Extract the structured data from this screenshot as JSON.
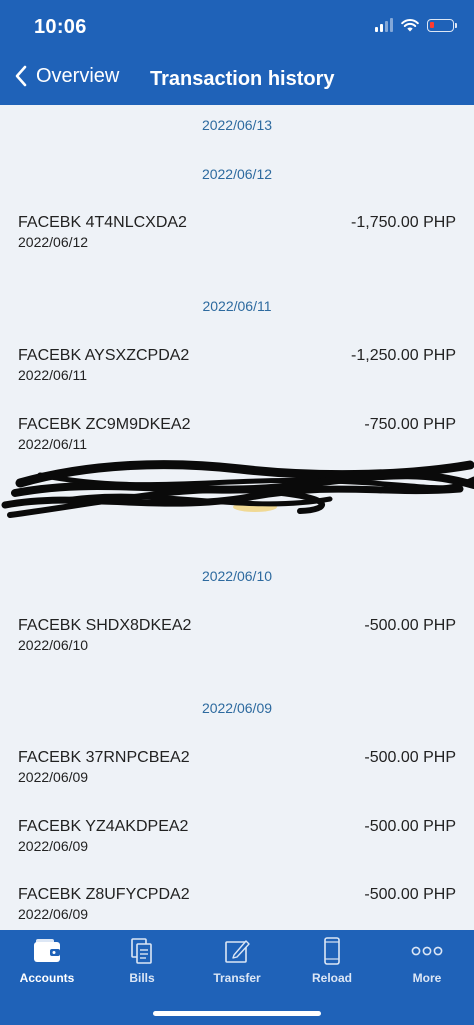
{
  "status_bar": {
    "time": "10:06"
  },
  "nav": {
    "back_label": "Overview",
    "title": "Transaction history"
  },
  "list": {
    "date_headers": [
      "2022/06/13",
      "2022/06/12",
      "2022/06/11",
      "2022/06/10",
      "2022/06/09"
    ],
    "transactions": [
      {
        "name": "FACEBK 4T4NLCXDA2",
        "date": "2022/06/12",
        "amount": "-1,750.00 PHP"
      },
      {
        "name": "FACEBK AYSXZCPDA2",
        "date": "2022/06/11",
        "amount": "-1,250.00 PHP"
      },
      {
        "name": "FACEBK ZC9M9DKEA2",
        "date": "2022/06/11",
        "amount": "-750.00 PHP"
      },
      {
        "name": "FACEBK SHDX8DKEA2",
        "date": "2022/06/10",
        "amount": "-500.00 PHP"
      },
      {
        "name": "FACEBK 37RNPCBEA2",
        "date": "2022/06/09",
        "amount": "-500.00 PHP"
      },
      {
        "name": "FACEBK YZ4AKDPEA2",
        "date": "2022/06/09",
        "amount": "-500.00 PHP"
      },
      {
        "name": "FACEBK Z8UFYCPDA2",
        "date": "2022/06/09",
        "amount": "-500.00 PHP"
      }
    ]
  },
  "tabbar": {
    "tabs": [
      {
        "label": "Accounts",
        "icon": "wallet-icon",
        "active": true
      },
      {
        "label": "Bills",
        "icon": "bills-icon",
        "active": false
      },
      {
        "label": "Transfer",
        "icon": "transfer-icon",
        "active": false
      },
      {
        "label": "Reload",
        "icon": "phone-icon",
        "active": false
      },
      {
        "label": "More",
        "icon": "more-icon",
        "active": false
      }
    ]
  },
  "colors": {
    "brand_blue": "#1f62b8",
    "background": "#eef2f7",
    "date_header": "#2d6a9f",
    "text": "#222222"
  }
}
